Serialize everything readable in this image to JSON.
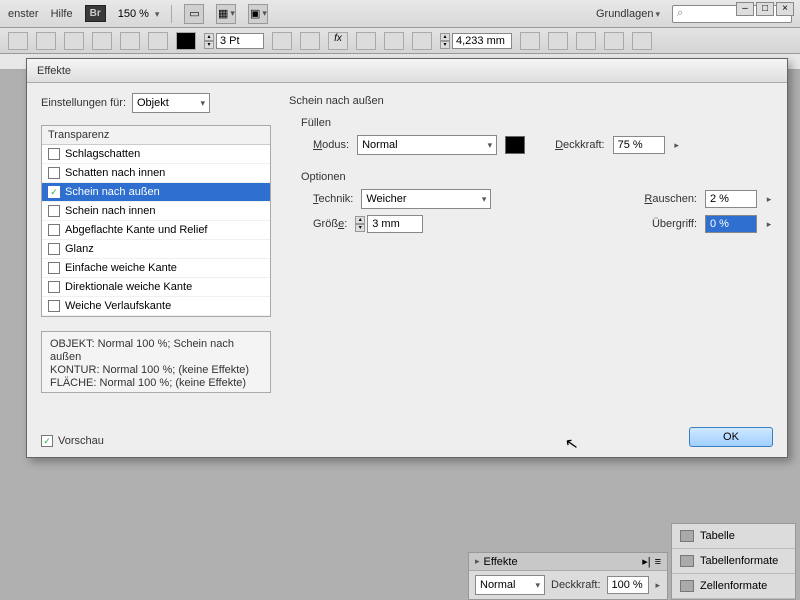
{
  "topbar": {
    "menu_fenster": "enster",
    "menu_hilfe": "Hilfe",
    "br": "Br",
    "zoom": "150 %",
    "workspace": "Grundlagen"
  },
  "toolbar2": {
    "pt_value": "3 Pt",
    "mm_value": "4,233 mm"
  },
  "dialog": {
    "title": "Effekte",
    "settings_label": "Einstellungen für:",
    "settings_value": "Objekt",
    "list_header": "Transparenz",
    "items": [
      {
        "label": "Schlagschatten",
        "checked": false
      },
      {
        "label": "Schatten nach innen",
        "checked": false
      },
      {
        "label": "Schein nach außen",
        "checked": true
      },
      {
        "label": "Schein nach innen",
        "checked": false
      },
      {
        "label": "Abgeflachte Kante und Relief",
        "checked": false
      },
      {
        "label": "Glanz",
        "checked": false
      },
      {
        "label": "Einfache weiche Kante",
        "checked": false
      },
      {
        "label": "Direktionale weiche Kante",
        "checked": false
      },
      {
        "label": "Weiche Verlaufskante",
        "checked": false
      }
    ],
    "summary1": "OBJEKT: Normal 100 %; Schein nach außen",
    "summary2": "KONTUR: Normal 100 %; (keine Effekte)",
    "summary3": "FLÄCHE: Normal 100 %; (keine Effekte)",
    "preview_label": "Vorschau",
    "right_title": "Schein nach außen",
    "fill_label": "Füllen",
    "modus_label": "Modus:",
    "modus_value": "Normal",
    "deckkraft_label": "Deckkraft:",
    "deckkraft_value": "75 %",
    "optionen_label": "Optionen",
    "technik_label": "Technik:",
    "technik_value": "Weicher",
    "rauschen_label": "Rauschen:",
    "rauschen_value": "2 %",
    "groesse_label": "Größe:",
    "groesse_value": "3 mm",
    "uebergriff_label": "Übergriff:",
    "uebergriff_value": "0 %",
    "ok": "OK"
  },
  "panels": {
    "tabelle": "Tabelle",
    "tabellenformate": "Tabellenformate",
    "zellenformate": "Zellenformate",
    "effekte_title": "Effekte",
    "effekte_mode": "Normal",
    "effekte_deck_label": "Deckkraft:",
    "effekte_deck_value": "100 %"
  }
}
